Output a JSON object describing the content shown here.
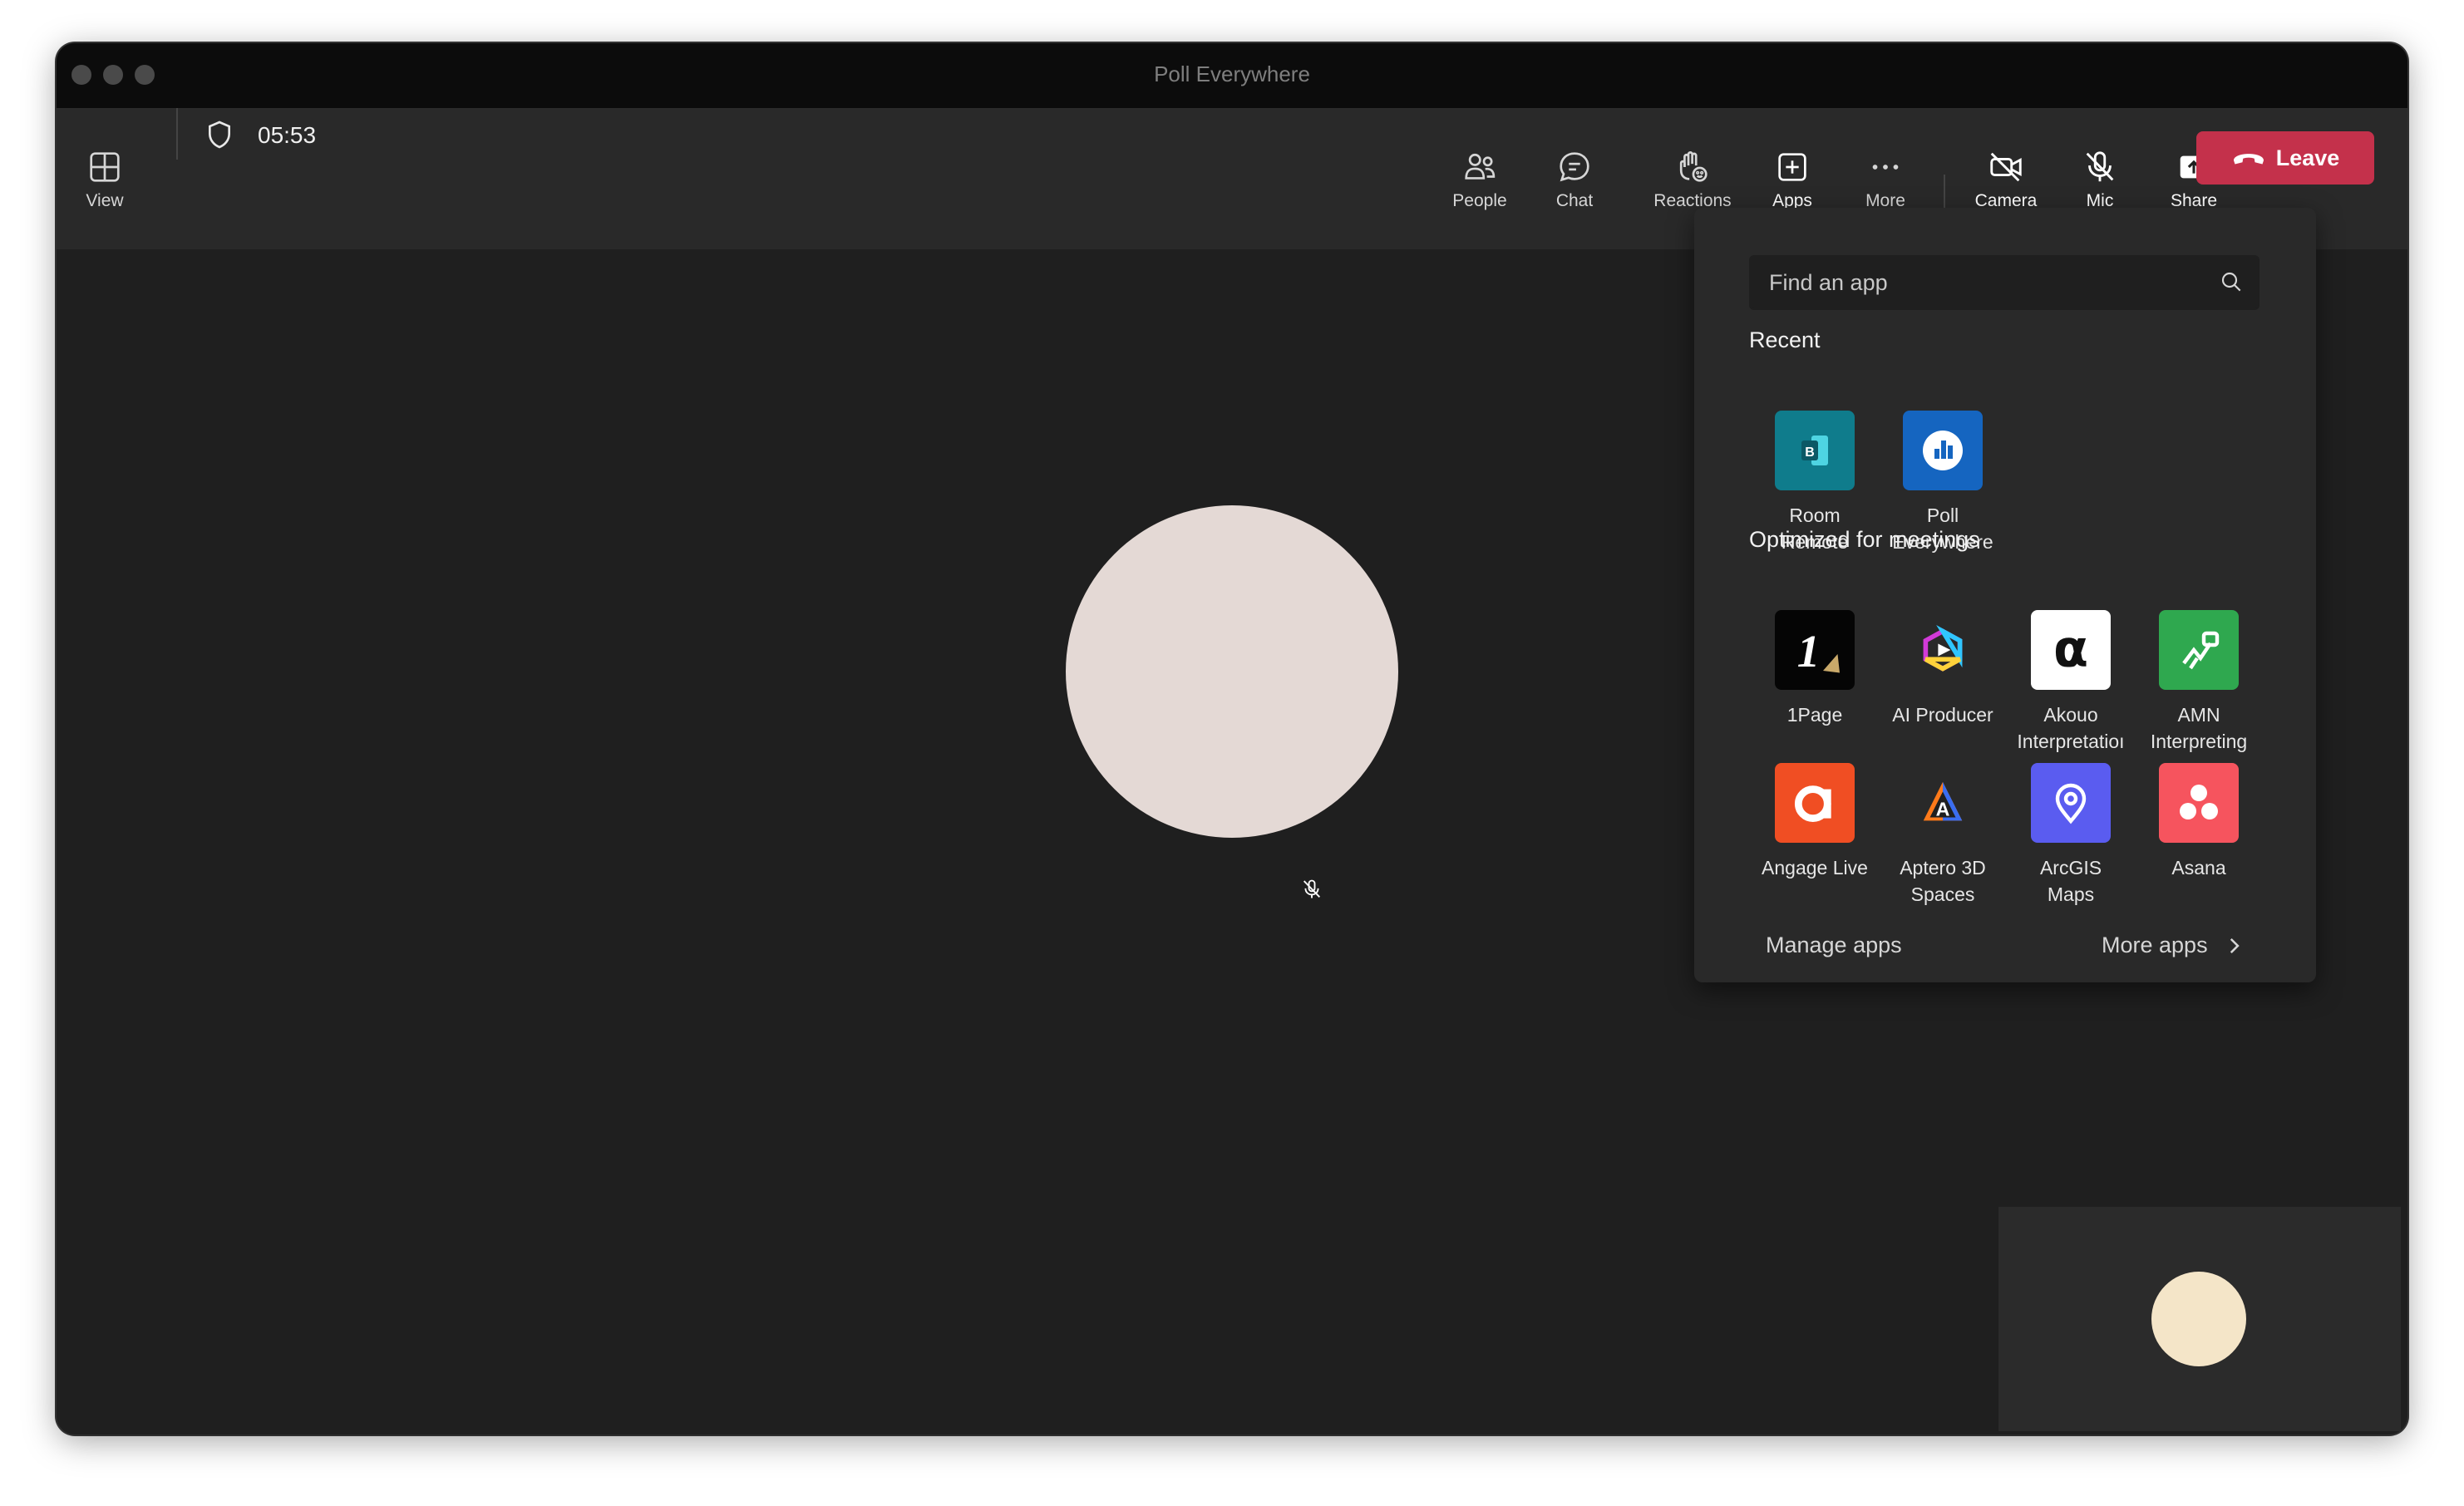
{
  "window": {
    "title": "Poll Everywhere"
  },
  "toolbar": {
    "view_label": "View",
    "timer": "05:53",
    "people_label": "People",
    "chat_label": "Chat",
    "reactions_label": "Reactions",
    "apps_label": "Apps",
    "more_label": "More",
    "camera_label": "Camera",
    "mic_label": "Mic",
    "share_label": "Share",
    "leave_label": "Leave"
  },
  "apps_flyout": {
    "search_placeholder": "Find an app",
    "recent_title": "Recent",
    "recent": [
      {
        "line1": "Room",
        "line2": "Remote"
      },
      {
        "line1": "Poll",
        "line2": "Everywhere"
      }
    ],
    "optimized_title": "Optimized for meetings",
    "optimized": [
      {
        "line1": "1Page",
        "line2": ""
      },
      {
        "line1": "AI Producer",
        "line2": ""
      },
      {
        "line1": "Akouo",
        "line2": "Interpretatioı"
      },
      {
        "line1": "AMN",
        "line2": "Interpreting"
      },
      {
        "line1": "Angage Live",
        "line2": ""
      },
      {
        "line1": "Aptero 3D",
        "line2": "Spaces"
      },
      {
        "line1": "ArcGIS",
        "line2": "Maps"
      },
      {
        "line1": "Asana",
        "line2": ""
      }
    ],
    "manage_apps": "Manage apps",
    "more_apps": "More apps"
  },
  "colors": {
    "leave": "#c4314b",
    "accent": "#7f85f5",
    "room_remote": "#0f7c8c",
    "poll_everywhere": "#1565c0",
    "amn": "#2fa84f",
    "angage": "#f04e23",
    "arcgis": "#5a5cf0",
    "asana": "#f6545e"
  },
  "icons": {
    "view": "grid-icon",
    "security": "shield-icon",
    "people": "people-icon",
    "chat": "chat-bubble-icon",
    "reactions": "raised-hand-icon",
    "apps": "plus-square-icon",
    "more": "ellipsis-icon",
    "camera": "camera-off-icon",
    "mic": "mic-off-icon",
    "share": "share-up-icon",
    "leave": "phone-hangup-icon",
    "search": "search-icon",
    "chevron": "chevron-right-icon"
  }
}
